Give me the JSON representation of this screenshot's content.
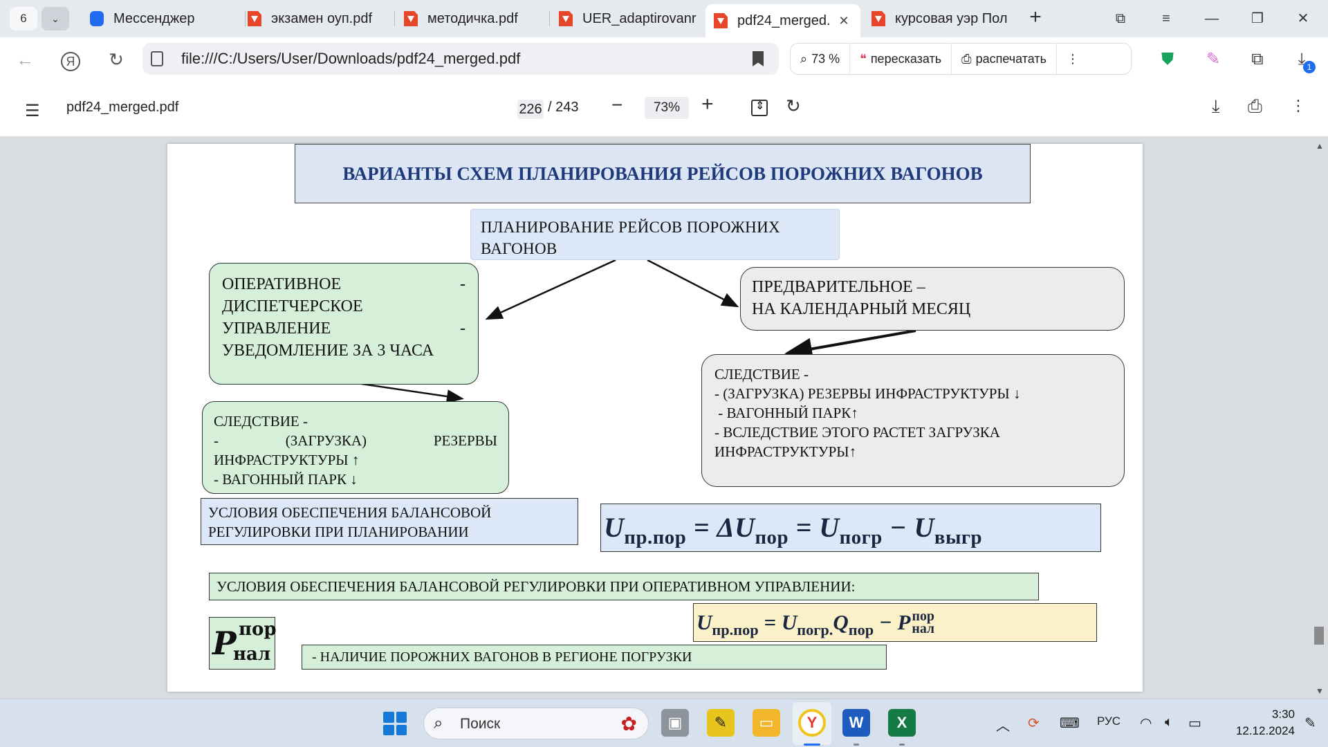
{
  "tabbar": {
    "count": "6",
    "tabs": [
      {
        "label": "Мессенджер",
        "icon": "messenger-icon"
      },
      {
        "label": "экзамен оуп.pdf",
        "icon": "pdf-icon"
      },
      {
        "label": "методичка.pdf",
        "icon": "pdf-icon"
      },
      {
        "label": "UER_adaptirovanr",
        "icon": "pdf-icon"
      },
      {
        "label": "pdf24_merged.",
        "icon": "pdf-icon",
        "active": true
      },
      {
        "label": "курсовая уэр Пол",
        "icon": "pdf-icon"
      }
    ],
    "close_glyph": "✕",
    "newtab_glyph": "+"
  },
  "addressbar": {
    "url": "file:///C:/Users/User/Downloads/pdf24_merged.pdf",
    "zoom_label": "73 %",
    "retell_label": "пересказать",
    "print_label": "распечатать",
    "download_badge": "1"
  },
  "pdfbar": {
    "filename": "pdf24_merged.pdf",
    "current_page": "226",
    "total_pages": "/ 243",
    "zoom": "73%"
  },
  "slide": {
    "title": "ВАРИАНТЫ СХЕМ ПЛАНИРОВАНИЯ РЕЙСОВ ПОРОЖНИХ ВАГОНОВ",
    "root": "ПЛАНИРОВАНИЕ  РЕЙСОВ  ПОРОЖНИХ ВАГОНОВ",
    "operative": {
      "line1a": "ОПЕРАТИВНОЕ",
      "line1b": "-",
      "line2": "ДИСПЕТЧЕРСКОЕ",
      "line3a": "УПРАВЛЕНИЕ",
      "line3b": "-",
      "line4": "УВЕДОМЛЕНИЕ ЗА 3 ЧАСА"
    },
    "preliminary": {
      "line1": "ПРЕДВАРИТЕЛЬНОЕ –",
      "line2": "НА КАЛЕНДАРНЫЙ МЕСЯЦ"
    },
    "consequence_left": {
      "line1": "СЛЕДСТВИЕ -",
      "line2a": "-",
      "line2b": "(ЗАГРУЗКА)",
      "line2c": "РЕЗЕРВЫ",
      "line3": "ИНФРАСТРУКТУРЫ ↑",
      "line4": "- ВАГОННЫЙ ПАРК ↓"
    },
    "consequence_right": {
      "line1": "СЛЕДСТВИЕ -",
      "line2": "- (ЗАГРУЗКА) РЕЗЕРВЫ ИНФРАСТРУКТУРЫ  ↓",
      "line3": " - ВАГОННЫЙ ПАРК↑",
      "line4": "- ВСЛЕДСТВИЕ ЭТОГО РАСТЕТ ЗАГРУЗКА",
      "line5": "ИНФРАСТРУКТУРЫ↑"
    },
    "condition_planning": "УСЛОВИЯ ОБЕСПЕЧЕНИЯ БАЛАНСОВОЙ РЕГУЛИРОВКИ ПРИ ПЛАНИРОВАНИИ",
    "formula1": {
      "u": "U",
      "sub1": "пр.пор",
      "eq1": " = ΔU",
      "sub2": "пор",
      "eq2": " = U",
      "sub3": "погр",
      "eq3": " − U",
      "sub4": "выгр"
    },
    "condition_operative": "УСЛОВИЯ ОБЕСПЕЧЕНИЯ БАЛАНСОВОЙ РЕГУЛИРОВКИ ПРИ ОПЕРАТИВНОМ УПРАВЛЕНИИ:",
    "formula2": {
      "u": "U",
      "sub1": "пр.пор",
      "eq1": " = U",
      "sub2": "погр.",
      "q": "Q",
      "sub3": "пор",
      "eq3": " − P",
      "sup4": "пор",
      "sub4": "нал"
    },
    "psym": {
      "p": "P",
      "sup": "пор",
      "sub": "нал"
    },
    "psym_desc": "- НАЛИЧИЕ ПОРОЖНИХ ВАГОНОВ В РЕГИОНЕ ПОГРУЗКИ"
  },
  "taskbar": {
    "search_placeholder": "Поиск",
    "lang": "РУС",
    "time": "3:30",
    "date": "12.12.2024"
  },
  "colors": {
    "title_bg": "#dbe5f4",
    "title_text": "#1f3a7a",
    "green_box": "#d5efd9",
    "gray_box": "#ececec",
    "formula_yellow": "#fbf1c8"
  }
}
